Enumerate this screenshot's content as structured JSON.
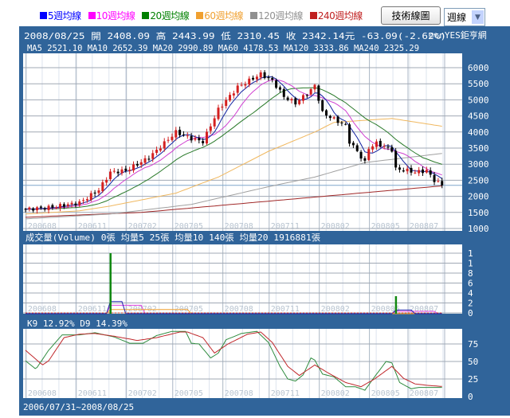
{
  "legend": [
    {
      "label": "5週均線",
      "color": "#0000ff"
    },
    {
      "label": "10週均線",
      "color": "#ff00ff"
    },
    {
      "label": "20週均線",
      "color": "#008000"
    },
    {
      "label": "60週均線",
      "color": "#f0a030"
    },
    {
      "label": "120週均線",
      "color": "#909090"
    },
    {
      "label": "240週均線",
      "color": "#c02020"
    }
  ],
  "toolbar": {
    "chart_button": "技術線圖",
    "period_select": "週線"
  },
  "info": {
    "quote_line": "2008/08/25 開 2408.09 高 2443.99 低 2310.45 收 2342.14元 -63.09(-2.62%)",
    "copyright": "©cnYES鉅亨網",
    "ma_line": "MA5 2521.10  MA10 2652.39  MA20 2990.89  MA60 4178.53  MA120 3333.86  MA240 2325.29"
  },
  "volume_title": "成交量(Volume) 0張  均量5 25張  均量10 140張  均量20 1916881張",
  "kd_title": "K9 12.92%  D9 14.39%",
  "footer": "2006/07/31~2008/08/25",
  "colors": {
    "panel": "#30649a",
    "up": "#d42020",
    "down": "#000000",
    "k": "#2e8b3e",
    "d": "#c0282c"
  },
  "chart_data": [
    {
      "type": "candlestick",
      "title": "Weekly price",
      "x_unit": "week index from 2006/07/31",
      "month_labels": [
        {
          "week": 1,
          "label": "200608"
        },
        {
          "week": 14,
          "label": "200611"
        },
        {
          "week": 27,
          "label": "200702"
        },
        {
          "week": 39,
          "label": "200705"
        },
        {
          "week": 52,
          "label": "200708"
        },
        {
          "week": 64,
          "label": "200711"
        },
        {
          "week": 77,
          "label": "200802"
        },
        {
          "week": 90,
          "label": "200805"
        },
        {
          "week": 100,
          "label": "200807"
        }
      ],
      "y_ticks": [
        6000,
        5500,
        5000,
        4500,
        4000,
        3500,
        3000,
        2500,
        2000,
        1500,
        1000
      ],
      "ylim": [
        1000,
        6000
      ],
      "close_keypoints": [
        [
          0,
          1600
        ],
        [
          6,
          1650
        ],
        [
          14,
          1800
        ],
        [
          19,
          2200
        ],
        [
          22,
          2750
        ],
        [
          26,
          2800
        ],
        [
          32,
          3200
        ],
        [
          39,
          4000
        ],
        [
          43,
          3800
        ],
        [
          46,
          3700
        ],
        [
          50,
          4700
        ],
        [
          55,
          5400
        ],
        [
          61,
          5800
        ],
        [
          64,
          5600
        ],
        [
          67,
          5100
        ],
        [
          70,
          4900
        ],
        [
          74,
          5300
        ],
        [
          75,
          5450
        ],
        [
          77,
          4600
        ],
        [
          80,
          4400
        ],
        [
          83,
          4200
        ],
        [
          84,
          3700
        ],
        [
          86,
          3400
        ],
        [
          88,
          3050
        ],
        [
          89,
          3500
        ],
        [
          91,
          3650
        ],
        [
          93,
          3550
        ],
        [
          95,
          3450
        ],
        [
          96,
          2850
        ],
        [
          99,
          2800
        ],
        [
          101,
          2750
        ],
        [
          104,
          2800
        ],
        [
          106,
          2500
        ],
        [
          108,
          2342.14
        ]
      ],
      "ma60_keypoints": [
        [
          0,
          1450
        ],
        [
          14,
          1550
        ],
        [
          22,
          1700
        ],
        [
          39,
          2100
        ],
        [
          50,
          2600
        ],
        [
          63,
          3400
        ],
        [
          75,
          4000
        ],
        [
          80,
          4300
        ],
        [
          95,
          4420
        ],
        [
          108,
          4178.53
        ]
      ],
      "ma120_keypoints": [
        [
          0,
          1300
        ],
        [
          22,
          1450
        ],
        [
          43,
          1750
        ],
        [
          63,
          2300
        ],
        [
          75,
          2600
        ],
        [
          88,
          3050
        ],
        [
          108,
          3333.86
        ]
      ],
      "ma240_keypoints": [
        [
          0,
          1350
        ],
        [
          30,
          1500
        ],
        [
          63,
          1850
        ],
        [
          108,
          2325.29
        ]
      ],
      "last_close": 2342.14
    },
    {
      "type": "bar",
      "title": "成交量(Volume)",
      "y_ticks": [
        "1",
        "1",
        "8",
        "6",
        "4",
        "2",
        "0"
      ],
      "volume_pct_of_scale": [
        [
          22,
          100
        ],
        [
          96,
          29
        ]
      ],
      "ma_pct": {
        "ma5": [
          [
            21,
            0
          ],
          [
            22,
            20
          ],
          [
            25,
            20
          ],
          [
            26,
            0
          ],
          [
            95,
            0
          ],
          [
            96,
            6
          ],
          [
            100,
            6
          ],
          [
            101,
            0
          ]
        ],
        "ma10": [
          [
            21,
            0
          ],
          [
            22,
            14
          ],
          [
            30,
            14
          ],
          [
            31,
            0
          ],
          [
            95,
            0
          ],
          [
            96,
            4
          ],
          [
            106,
            4
          ],
          [
            107,
            0
          ]
        ],
        "ma20": [
          [
            21,
            0
          ],
          [
            22,
            7
          ],
          [
            42,
            7
          ],
          [
            43,
            0
          ]
        ]
      }
    },
    {
      "type": "line",
      "title": "KD",
      "y_ticks": [
        75,
        50,
        25,
        0
      ],
      "ylim": [
        0,
        100
      ],
      "series": [
        {
          "name": "K9",
          "points": [
            [
              0,
              51
            ],
            [
              2.7,
              39
            ],
            [
              6,
              66
            ],
            [
              9.5,
              88
            ],
            [
              14,
              88
            ],
            [
              18,
              91
            ],
            [
              23,
              85
            ],
            [
              27,
              76
            ],
            [
              30.5,
              76
            ],
            [
              34,
              87
            ],
            [
              38,
              93
            ],
            [
              41.5,
              93
            ],
            [
              43,
              76
            ],
            [
              45,
              75
            ],
            [
              48,
              55
            ],
            [
              50,
              62
            ],
            [
              52,
              81
            ],
            [
              56,
              90
            ],
            [
              60,
              93
            ],
            [
              63,
              77
            ],
            [
              66,
              43
            ],
            [
              68,
              25
            ],
            [
              70,
              22
            ],
            [
              72,
              31
            ],
            [
              74,
              55
            ],
            [
              75,
              52
            ],
            [
              77,
              32
            ],
            [
              80,
              28
            ],
            [
              83,
              14
            ],
            [
              85.5,
              14
            ],
            [
              88,
              9
            ],
            [
              90.5,
              28
            ],
            [
              93.5,
              50
            ],
            [
              95,
              48
            ],
            [
              97,
              20
            ],
            [
              100,
              11
            ],
            [
              102,
              13
            ],
            [
              108,
              12.92
            ]
          ]
        },
        {
          "name": "D9",
          "points": [
            [
              0,
              66
            ],
            [
              4.4,
              45
            ],
            [
              6,
              51
            ],
            [
              10,
              84
            ],
            [
              14,
              89
            ],
            [
              18,
              90
            ],
            [
              23,
              86
            ],
            [
              29,
              80
            ],
            [
              34,
              84
            ],
            [
              40,
              92
            ],
            [
              42,
              92
            ],
            [
              46,
              84
            ],
            [
              49,
              62
            ],
            [
              52.5,
              75
            ],
            [
              57.6,
              89
            ],
            [
              61,
              92
            ],
            [
              64,
              77
            ],
            [
              68,
              43
            ],
            [
              71,
              30
            ],
            [
              75,
              45
            ],
            [
              79,
              32
            ],
            [
              83,
              20
            ],
            [
              87,
              14
            ],
            [
              90.5,
              25
            ],
            [
              95,
              43
            ],
            [
              98,
              26
            ],
            [
              101,
              18
            ],
            [
              104,
              16
            ],
            [
              108,
              14.39
            ]
          ]
        }
      ]
    }
  ]
}
